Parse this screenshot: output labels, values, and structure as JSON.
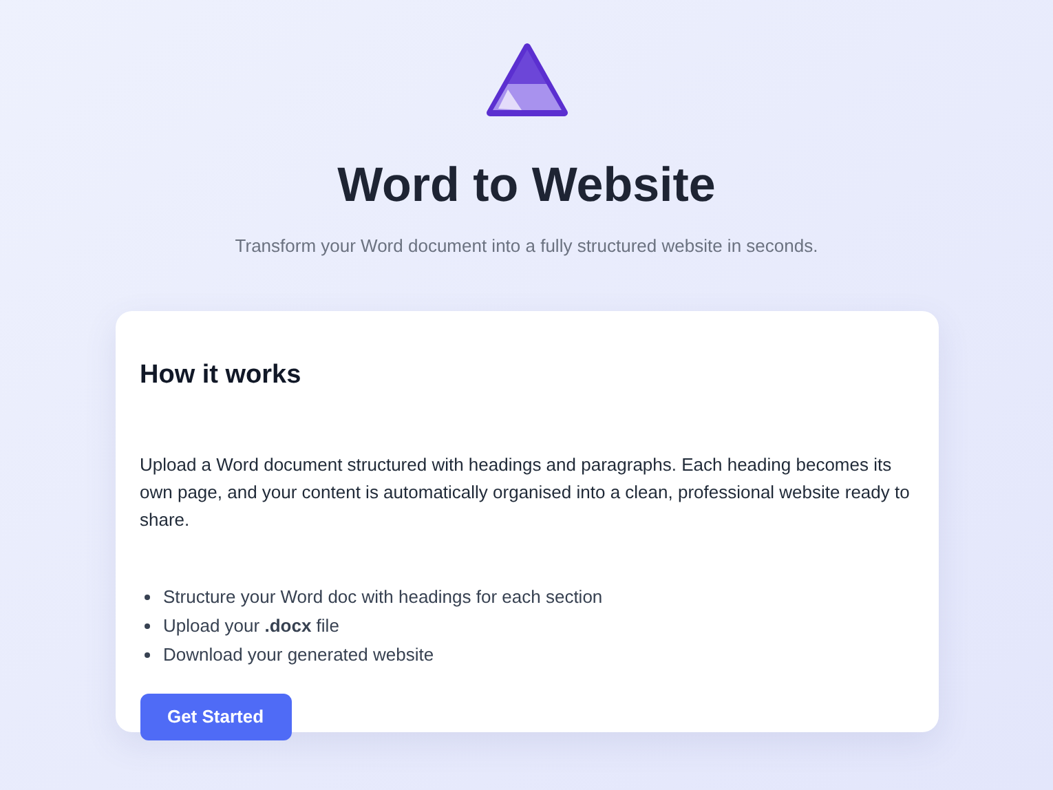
{
  "header": {
    "title": "Word to Website",
    "subtitle": "Transform your Word document into a fully structured website in seconds."
  },
  "card": {
    "heading": "How it works",
    "description": "Upload a Word document structured with headings and paragraphs. Each heading becomes its own page, and your content is automatically organised into a clean, professional website ready to share.",
    "steps": [
      "Structure your Word doc with headings for each section",
      "Upload your **.docx** file",
      "Download your generated website"
    ],
    "button": "Get Started"
  }
}
